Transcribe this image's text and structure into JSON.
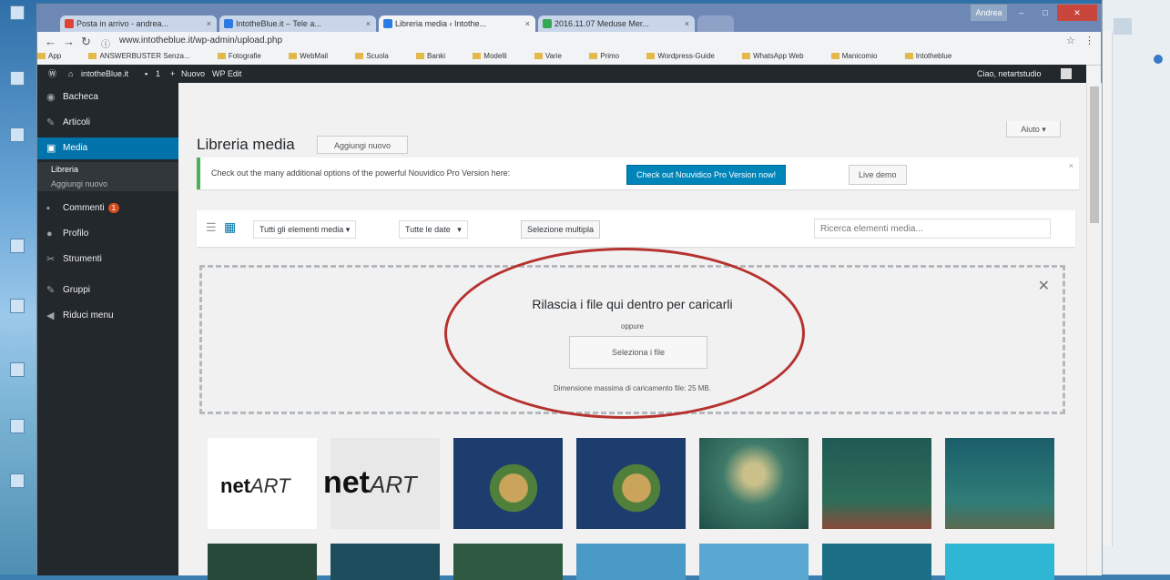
{
  "browser": {
    "tabs": [
      {
        "label": "Posta in arrivo - andrea...",
        "active": false,
        "color": "#db4437"
      },
      {
        "label": "IntotheBlue.it – Tele a...",
        "active": false,
        "color": "#2a7ae2"
      },
      {
        "label": "Libreria media ‹ Intothe...",
        "active": true,
        "color": "#2a7ae2"
      },
      {
        "label": "2016.11.07 Meduse Mer...",
        "active": false,
        "color": "#34a853"
      }
    ],
    "user": "Andrea",
    "url": "www.intotheblue.it/wp-admin/upload.php",
    "bookmarks": [
      "App",
      "ANSWERBUSTER Senza...",
      "Fotografie",
      "WebMail",
      "Scuola",
      "Banki",
      "Modelli",
      "Varie",
      "Primo",
      "Wordpress-Guide",
      "WhatsApp Web",
      "Manicomio",
      "Intotheblue"
    ]
  },
  "adminbar": {
    "site": "intotheBlue.it",
    "comments": "1",
    "new": "Nuovo",
    "wpedit": "WP Edit",
    "greeting": "Ciao, netartstudio"
  },
  "sidebar": {
    "items": [
      {
        "label": "Bacheca",
        "icon": "dashboard-icon"
      },
      {
        "label": "Articoli",
        "icon": "pin-icon"
      },
      {
        "label": "Media",
        "icon": "media-icon",
        "active": true
      },
      {
        "label": "Commenti",
        "icon": "comment-icon",
        "badge": "1"
      },
      {
        "label": "Profilo",
        "icon": "user-icon"
      },
      {
        "label": "Strumenti",
        "icon": "wrench-icon"
      },
      {
        "label": "Gruppi",
        "icon": "groups-icon"
      },
      {
        "label": "Riduci menu",
        "icon": "collapse-icon"
      }
    ],
    "submenu": [
      "Libreria",
      "Aggiungi nuovo"
    ]
  },
  "page": {
    "title": "Libreria media",
    "add_new": "Aggiungi nuovo",
    "help": "Aiuto ▾",
    "notice": "Check out the many additional options of the powerful Nouvidico Pro Version here:",
    "notice_cta": "Check out Nouvidico Pro Version now!",
    "notice_demo": "Live demo",
    "filter_type": "Tutti gli elementi media",
    "filter_date": "Tutte le date",
    "bulk_select": "Selezione multipla",
    "search_placeholder": "Ricerca elementi media...",
    "drop_heading": "Rilascia i file qui dentro per caricarli",
    "drop_or": "oppure",
    "select_files": "Seleziona i file",
    "max_size": "Dimensione massima di caricamento file: 25 MB."
  },
  "colors": {
    "accent": "#0073aa",
    "oval": "#b5322f",
    "notice_border": "#46b450"
  }
}
